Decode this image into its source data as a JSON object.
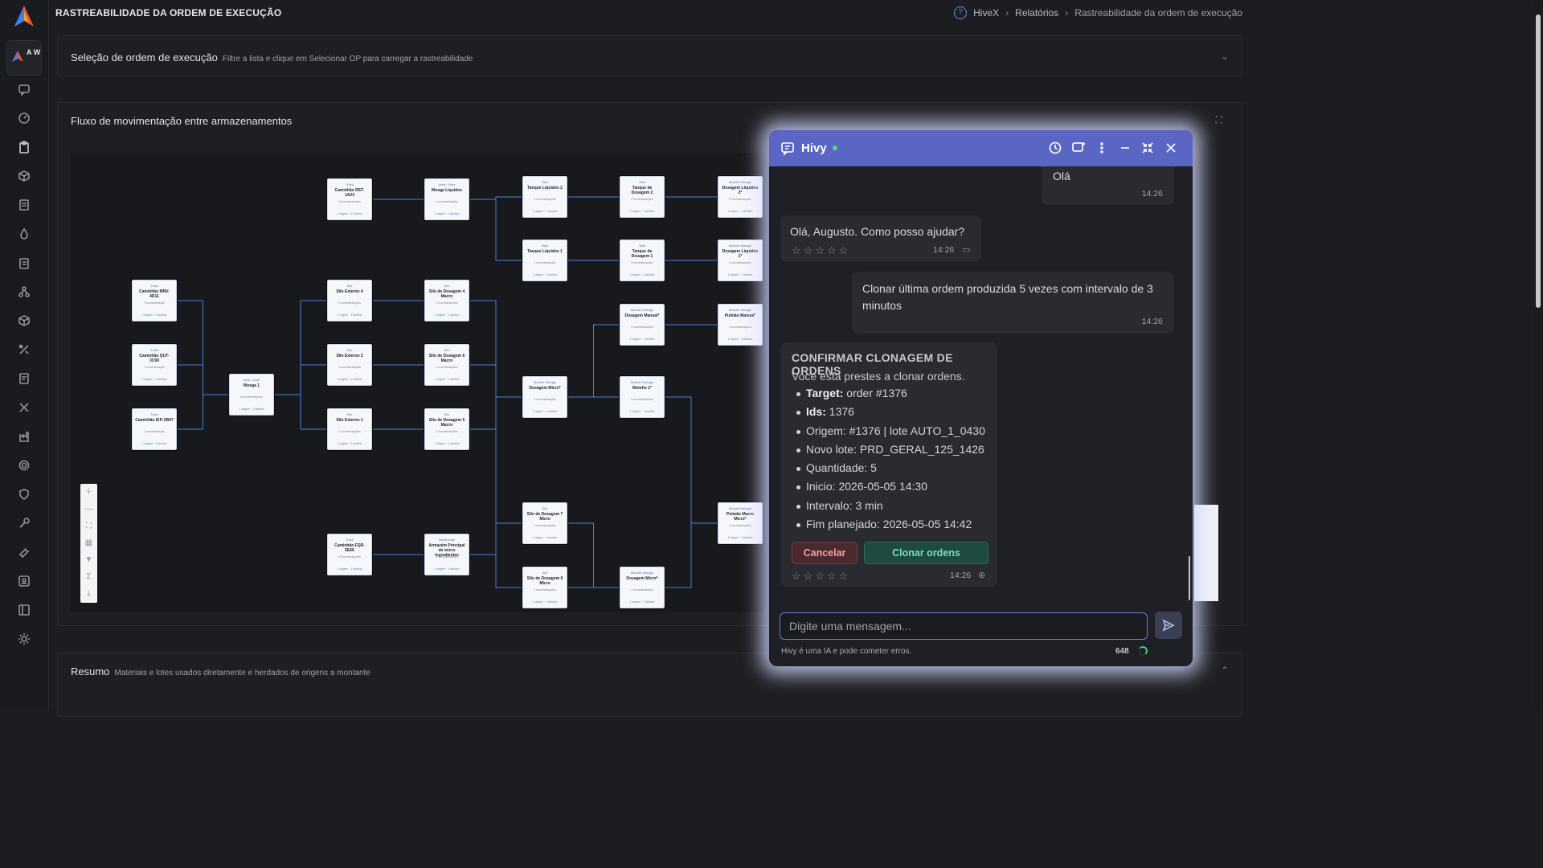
{
  "topbar": {
    "page_title": "RASTREABILIDADE DA ORDEM DE EXECUÇÃO",
    "breadcrumb": [
      "HiveX",
      "Relatórios",
      "Rastreabilidade da ordem de execução"
    ]
  },
  "sidebar": {
    "avatar_text": "A W",
    "icons": [
      "chat-icon",
      "gauge-icon",
      "clipboard-icon",
      "box-icon",
      "document-icon",
      "droplet-icon",
      "clipboard-list-icon",
      "flask-icon",
      "package-icon",
      "tools-icon",
      "file-icon",
      "tools-alt-icon",
      "factory-icon",
      "gear-icon",
      "shield-icon",
      "key-icon",
      "wrench-icon",
      "user-badge-icon",
      "panel-icon",
      "sun-icon"
    ]
  },
  "selection_panel": {
    "title": "Seleção de ordem de execução",
    "subtitle": "Filtre a lista e clique em Selecionar OP para carregar a rastreabilidade"
  },
  "flow_panel": {
    "title": "Fluxo de movimentação entre armazenamentos",
    "nodes": [
      {
        "type": "Truck",
        "name": "Caminhão RST-1A23",
        "sub": "3 movimentações"
      },
      {
        "type": "Area / Zone",
        "name": "Moega Líquidos",
        "sub": "4 movimentações"
      },
      {
        "type": "Tank",
        "name": "Tanque Líquidos 2",
        "sub": "2 movimentações"
      },
      {
        "type": "Tank",
        "name": "Tanque de Dosagem 2",
        "sub": "2 movimentações"
      },
      {
        "type": "Module Storage",
        "name": "Dosagem Líquidos 2*",
        "sub": "2 movimentações"
      },
      {
        "type": "Tank",
        "name": "Tanque Líquidos 1",
        "sub": "2 movimentações"
      },
      {
        "type": "Tank",
        "name": "Tanque de Dosagem 1",
        "sub": "2 movimentações"
      },
      {
        "type": "Module Storage",
        "name": "Dosagem Líquidos 1*",
        "sub": "2 movimentações"
      },
      {
        "type": "Truck",
        "name": "Caminhão MNV-4D11",
        "sub": "1 movimentação"
      },
      {
        "type": "Silo",
        "name": "Silo Externo 4",
        "sub": "2 movimentações"
      },
      {
        "type": "Silo",
        "name": "Silo de Dosagem 4 Macro",
        "sub": "2 movimentações"
      },
      {
        "type": "Module Storage",
        "name": "Dosagem Manual*",
        "sub": "2 movimentações"
      },
      {
        "type": "Module Storage",
        "name": "Pulmão Manual*",
        "sub": "2 movimentações"
      },
      {
        "type": "Truck",
        "name": "Caminhão QUT-3C90",
        "sub": "1 movimentação"
      },
      {
        "type": "Area / Zone",
        "name": "Moega 1",
        "sub": "6 movimentações"
      },
      {
        "type": "Silo",
        "name": "Silo Externo 2",
        "sub": "2 movimentações"
      },
      {
        "type": "Silo",
        "name": "Silo de Dosagem 6 Macro",
        "sub": "2 movimentações"
      },
      {
        "type": "Module Storage",
        "name": "Dosagem Micro*",
        "sub": "4 movimentações"
      },
      {
        "type": "Module Storage",
        "name": "Moinho 1*",
        "sub": "3 movimentações"
      },
      {
        "type": "Truck",
        "name": "Caminhão IKP-2B47",
        "sub": "1 movimentação"
      },
      {
        "type": "Silo",
        "name": "Silo Externo 1",
        "sub": "2 movimentações"
      },
      {
        "type": "Silo",
        "name": "Silo de Dosagem 5 Macro",
        "sub": "2 movimentações"
      },
      {
        "type": "Silo",
        "name": "Silo de Dosagem 7 Micro",
        "sub": "2 movimentações"
      },
      {
        "type": "Module Storage",
        "name": "Pulmão Macro Micro*",
        "sub": "4 movimentações"
      },
      {
        "type": "Truck",
        "name": "Caminhão FQR-5E66",
        "sub": "4 movimentações"
      },
      {
        "type": "Warehouse",
        "name": "Armazém Principal de micro ingredientes",
        "sub": "6 movimentações"
      },
      {
        "type": "Silo",
        "name": "Silo de Dosagem 9 Micro",
        "sub": "2 movimentações"
      },
      {
        "type": "Module Storage",
        "name": "Dosagem Micro*",
        "sub": "2 movimentações"
      }
    ],
    "node_footer": "1 origem · 1 destino"
  },
  "summary_panel": {
    "title": "Resumo",
    "subtitle": "Materiais e lotes usados diretamente e herdados de origens a montante"
  },
  "chat": {
    "title": "Hivy",
    "status_color": "#4ade80",
    "accent": "#5b66c4",
    "messages": {
      "user1": {
        "text": "Olá",
        "time": "14:26"
      },
      "bot1": {
        "text": "Olá, Augusto. Como posso ajudar?",
        "time": "14:26",
        "stars": "☆☆☆☆☆"
      },
      "user2": {
        "text": "Clonar última ordem produzida 5 vezes com intervalo de 3 minutos",
        "time": "14:26"
      },
      "confirm": {
        "title": "CONFIRMAR CLONAGEM DE ORDENS",
        "desc": "Voce esta prestes a clonar ordens.",
        "items": [
          {
            "key": "Target:",
            "value": " order #1376"
          },
          {
            "key": "Ids:",
            "value": " 1376"
          },
          {
            "key": "",
            "value": "Origem: #1376 | lote AUTO_1_0430"
          },
          {
            "key": "",
            "value": "Novo lote: PRD_GERAL_125_1426"
          },
          {
            "key": "",
            "value": "Quantidade: 5"
          },
          {
            "key": "",
            "value": "Inicio: 2026-05-05 14:30"
          },
          {
            "key": "",
            "value": "Intervalo: 3 min"
          },
          {
            "key": "",
            "value": "Fim planejado: 2026-05-05 14:42"
          }
        ],
        "cancel_label": "Cancelar",
        "clone_label": "Clonar ordens",
        "time": "14:26",
        "stars": "☆☆☆☆☆"
      }
    },
    "input_placeholder": "Digite uma mensagem...",
    "disclaimer": "Hivy é uma IA e pode cometer erros.",
    "char_count": "648"
  }
}
